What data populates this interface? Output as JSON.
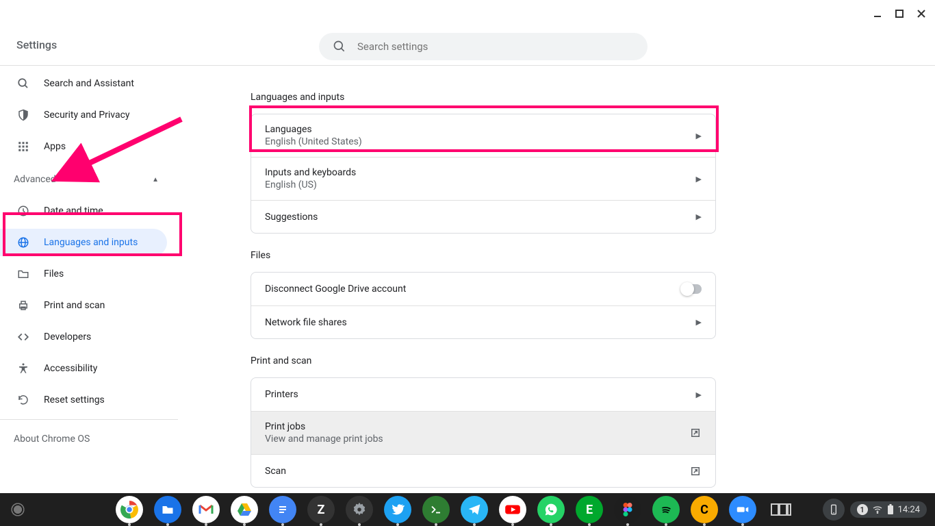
{
  "window": {
    "title": "Settings"
  },
  "search": {
    "placeholder": "Search settings"
  },
  "sidebar": {
    "items_top": [
      {
        "label": "Search and Assistant",
        "icon": "search"
      },
      {
        "label": "Security and Privacy",
        "icon": "shield"
      },
      {
        "label": "Apps",
        "icon": "apps"
      }
    ],
    "advanced_label": "Advanced",
    "items_adv": [
      {
        "label": "Date and time",
        "icon": "clock"
      },
      {
        "label": "Languages and inputs",
        "icon": "globe",
        "active": true
      },
      {
        "label": "Files",
        "icon": "folder"
      },
      {
        "label": "Print and scan",
        "icon": "print"
      },
      {
        "label": "Developers",
        "icon": "code"
      },
      {
        "label": "Accessibility",
        "icon": "accessibility"
      },
      {
        "label": "Reset settings",
        "icon": "reset"
      }
    ],
    "about_label": "About Chrome OS"
  },
  "content": {
    "section1": {
      "title": "Languages and inputs",
      "rows": [
        {
          "title": "Languages",
          "sub": "English (United States)",
          "action": "arrow"
        },
        {
          "title": "Inputs and keyboards",
          "sub": "English (US)",
          "action": "arrow"
        },
        {
          "title": "Suggestions",
          "action": "arrow"
        }
      ]
    },
    "section2": {
      "title": "Files",
      "rows": [
        {
          "title": "Disconnect Google Drive account",
          "action": "toggle-off"
        },
        {
          "title": "Network file shares",
          "action": "arrow"
        }
      ]
    },
    "section3": {
      "title": "Print and scan",
      "rows": [
        {
          "title": "Printers",
          "action": "arrow"
        },
        {
          "title": "Print jobs",
          "sub": "View and manage print jobs",
          "action": "open",
          "hover": true
        },
        {
          "title": "Scan",
          "action": "open"
        }
      ]
    }
  },
  "shelf": {
    "apps": [
      {
        "name": "chrome",
        "bg": "#fff"
      },
      {
        "name": "files",
        "bg": "#1a73e8"
      },
      {
        "name": "gmail",
        "bg": "#fff"
      },
      {
        "name": "drive",
        "bg": "#fff"
      },
      {
        "name": "docs",
        "bg": "#4285f4"
      },
      {
        "name": "zapp",
        "bg": "#333",
        "letter": "Z"
      },
      {
        "name": "settings-app",
        "bg": "#333"
      },
      {
        "name": "twitter",
        "bg": "#1da1f2"
      },
      {
        "name": "terminal",
        "bg": "#2e7d32"
      },
      {
        "name": "telegram",
        "bg": "#29b6f6"
      },
      {
        "name": "youtube",
        "bg": "#fff"
      },
      {
        "name": "whatsapp",
        "bg": "#25d366"
      },
      {
        "name": "evernote",
        "bg": "#00a82d",
        "letter": "E"
      },
      {
        "name": "figma",
        "bg": "#1e1e1e"
      },
      {
        "name": "spotify",
        "bg": "#1db954"
      },
      {
        "name": "capp",
        "bg": "#f9ab00",
        "letter": "C"
      },
      {
        "name": "zoom",
        "bg": "#2d8cff"
      },
      {
        "name": "overview",
        "bg": "transparent"
      }
    ],
    "notification_count": "1",
    "time": "14:24"
  }
}
